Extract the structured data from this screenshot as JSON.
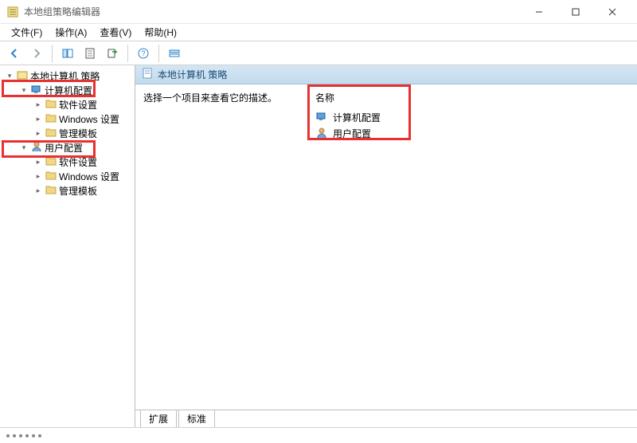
{
  "titlebar": {
    "title": "本地组策略编辑器"
  },
  "menu": {
    "file": "文件(F)",
    "action": "操作(A)",
    "view": "查看(V)",
    "help": "帮助(H)"
  },
  "tree": {
    "root": "本地计算机 策略",
    "computer": {
      "label": "计算机配置",
      "children": {
        "software": "软件设置",
        "windows": "Windows 设置",
        "templates": "管理模板"
      }
    },
    "user": {
      "label": "用户配置",
      "children": {
        "software": "软件设置",
        "windows": "Windows 设置",
        "templates": "管理模板"
      }
    }
  },
  "main": {
    "header": "本地计算机 策略",
    "description": "选择一个项目来查看它的描述。",
    "column_name": "名称",
    "items": {
      "computer": "计算机配置",
      "user": "用户配置"
    }
  },
  "tabs": {
    "extended": "扩展",
    "standard": "标准"
  }
}
